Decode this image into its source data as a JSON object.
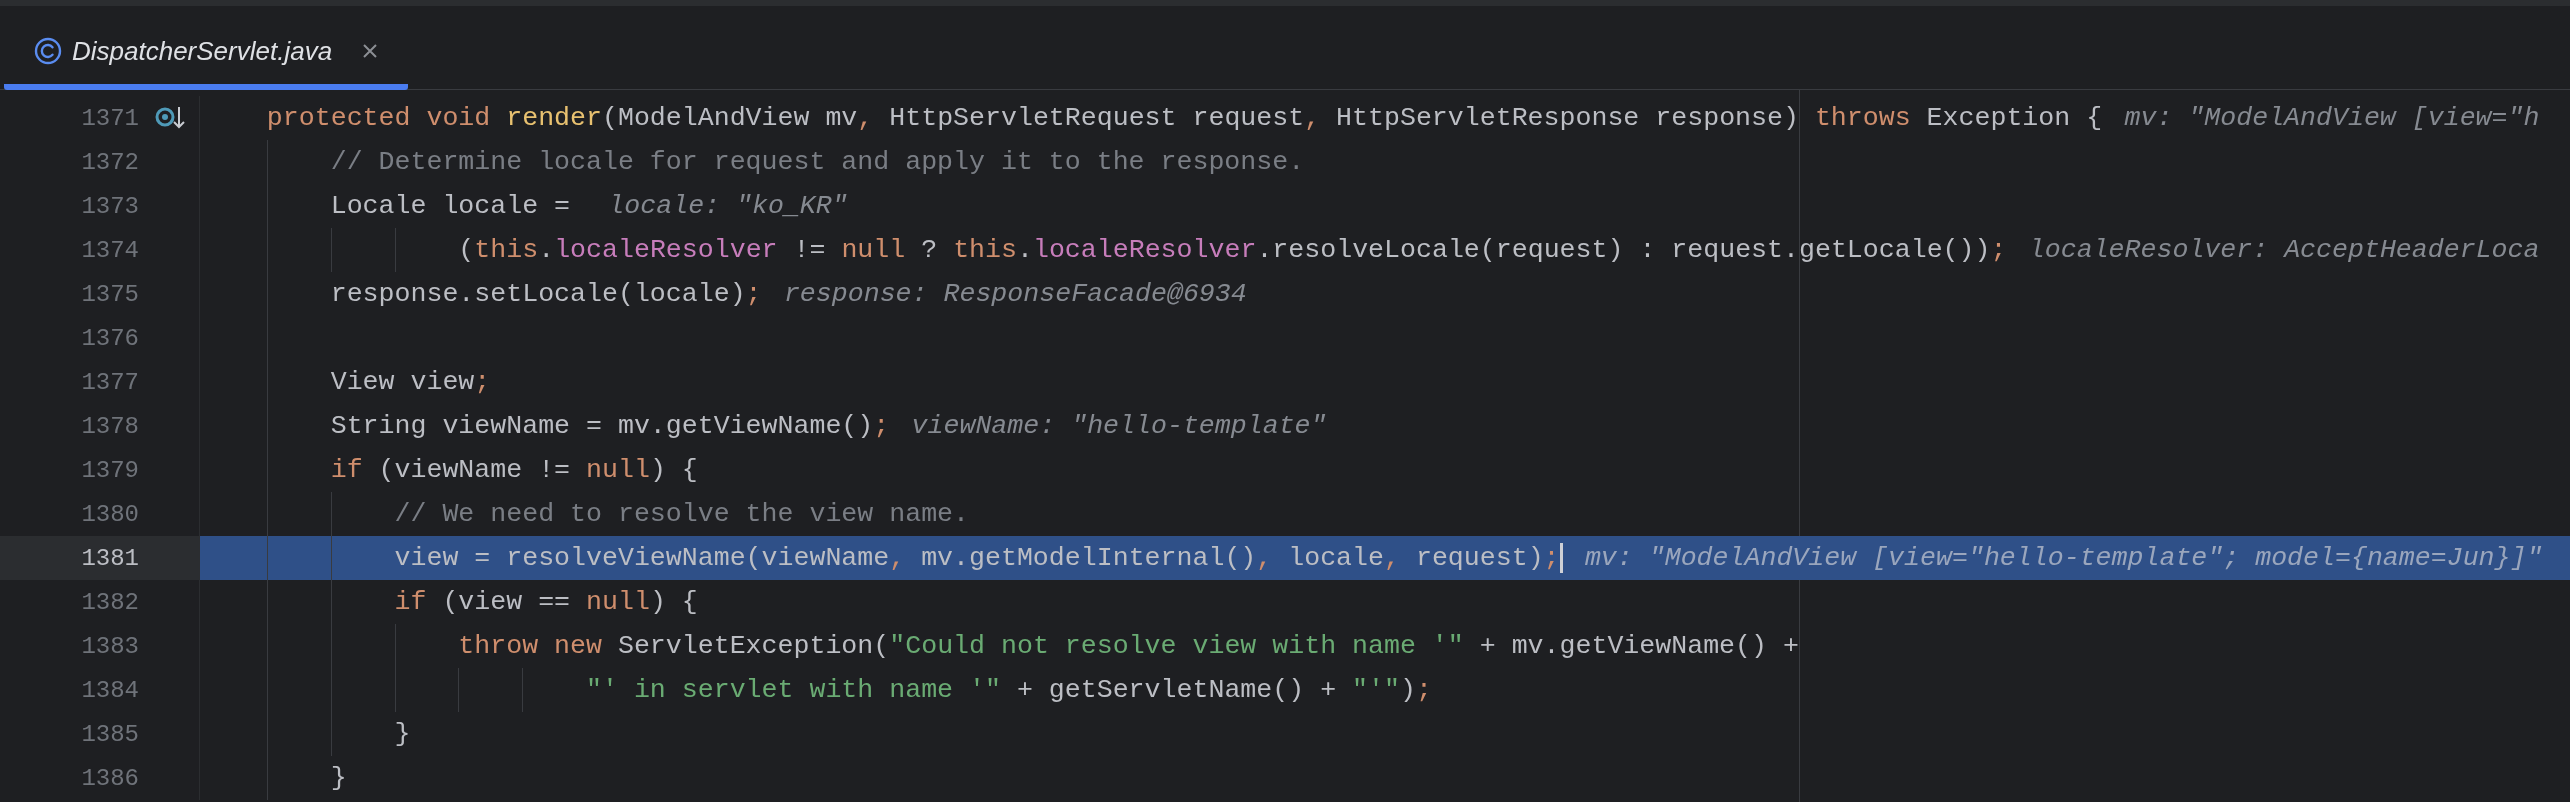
{
  "tabs": [
    {
      "label": "DispatcherServlet.java",
      "selected": true
    }
  ],
  "lines": [
    {
      "number": "1371",
      "current": false,
      "marker": true,
      "tokens": [
        {
          "kind": "keyword",
          "text": "    protected void "
        },
        {
          "kind": "declaration",
          "text": "render"
        },
        {
          "kind": "plain",
          "text": "(ModelAndView mv"
        },
        {
          "kind": "punct",
          "text": ","
        },
        {
          "kind": "plain",
          "text": " HttpServletRequest request"
        },
        {
          "kind": "punct",
          "text": ","
        },
        {
          "kind": "plain",
          "text": " HttpServletResponse response) "
        },
        {
          "kind": "keyword",
          "text": "throws"
        },
        {
          "kind": "plain",
          "text": " Exception {"
        }
      ],
      "hint": "mv: \"ModelAndView [view=\"h"
    },
    {
      "number": "1372",
      "current": false,
      "marker": false,
      "tokens": [
        {
          "kind": "comment",
          "text": "        // Determine locale for request and apply it to the response."
        }
      ]
    },
    {
      "number": "1373",
      "current": false,
      "marker": false,
      "tokens": [
        {
          "kind": "plain",
          "text": "        Locale locale = "
        }
      ],
      "hint": "locale: \"ko_KR\""
    },
    {
      "number": "1374",
      "current": false,
      "marker": false,
      "tokens": [
        {
          "kind": "plain",
          "text": "                ("
        },
        {
          "kind": "keyword",
          "text": "this"
        },
        {
          "kind": "plain",
          "text": "."
        },
        {
          "kind": "field",
          "text": "localeResolver"
        },
        {
          "kind": "plain",
          "text": " != "
        },
        {
          "kind": "keyword",
          "text": "null"
        },
        {
          "kind": "plain",
          "text": " ? "
        },
        {
          "kind": "keyword",
          "text": "this"
        },
        {
          "kind": "plain",
          "text": "."
        },
        {
          "kind": "field",
          "text": "localeResolver"
        },
        {
          "kind": "plain",
          "text": ".resolveLocale(request) : request.getLocale())"
        },
        {
          "kind": "punct",
          "text": ";"
        }
      ],
      "hint": "localeResolver: AcceptHeaderLoca"
    },
    {
      "number": "1375",
      "current": false,
      "marker": false,
      "tokens": [
        {
          "kind": "plain",
          "text": "        response.setLocale(locale)"
        },
        {
          "kind": "punct",
          "text": ";"
        }
      ],
      "hint": "response: ResponseFacade@6934"
    },
    {
      "number": "1376",
      "current": false,
      "marker": false
    },
    {
      "number": "1377",
      "current": false,
      "marker": false,
      "tokens": [
        {
          "kind": "plain",
          "text": "        View view"
        },
        {
          "kind": "punct",
          "text": ";"
        }
      ]
    },
    {
      "number": "1378",
      "current": false,
      "marker": false,
      "tokens": [
        {
          "kind": "plain",
          "text": "        String viewName = mv.getViewName()"
        },
        {
          "kind": "punct",
          "text": ";"
        }
      ],
      "hint": "viewName: \"hello-template\""
    },
    {
      "number": "1379",
      "current": false,
      "marker": false,
      "tokens": [
        {
          "kind": "keyword",
          "text": "        if"
        },
        {
          "kind": "plain",
          "text": " (viewName != "
        },
        {
          "kind": "keyword",
          "text": "null"
        },
        {
          "kind": "plain",
          "text": ") {"
        }
      ]
    },
    {
      "number": "1380",
      "current": false,
      "marker": false,
      "tokens": [
        {
          "kind": "comment",
          "text": "            // We need to resolve the view name."
        }
      ]
    },
    {
      "number": "1381",
      "current": true,
      "marker": false,
      "tokens": [
        {
          "kind": "plain",
          "text": "            view = resolveViewName(viewName"
        },
        {
          "kind": "punct",
          "text": ","
        },
        {
          "kind": "plain",
          "text": " mv.getModelInternal()"
        },
        {
          "kind": "punct",
          "text": ","
        },
        {
          "kind": "plain",
          "text": " locale"
        },
        {
          "kind": "punct",
          "text": ","
        },
        {
          "kind": "plain",
          "text": " request)"
        },
        {
          "kind": "punct",
          "text": ";"
        }
      ],
      "hint": "mv: \"ModelAndView [view=\"hello-template\"; model={name=Jun}]\""
    },
    {
      "number": "1382",
      "current": false,
      "marker": false,
      "tokens": [
        {
          "kind": "keyword",
          "text": "            if"
        },
        {
          "kind": "plain",
          "text": " (view == "
        },
        {
          "kind": "keyword",
          "text": "null"
        },
        {
          "kind": "plain",
          "text": ") {"
        }
      ]
    },
    {
      "number": "1383",
      "current": false,
      "marker": false,
      "tokens": [
        {
          "kind": "keyword",
          "text": "                throw new"
        },
        {
          "kind": "plain",
          "text": " ServletException("
        },
        {
          "kind": "string",
          "text": "\"Could not resolve view with name '\""
        },
        {
          "kind": "plain",
          "text": " + mv.getViewName() +"
        }
      ]
    },
    {
      "number": "1384",
      "current": false,
      "marker": false,
      "tokens": [
        {
          "kind": "string",
          "text": "                        \"' in servlet with name '\""
        },
        {
          "kind": "plain",
          "text": " + getServletName() + "
        },
        {
          "kind": "string",
          "text": "\"'\""
        },
        {
          "kind": "plain",
          "text": ")"
        },
        {
          "kind": "punct",
          "text": ";"
        }
      ]
    },
    {
      "number": "1385",
      "current": false,
      "marker": false,
      "tokens": [
        {
          "kind": "plain",
          "text": "            }"
        }
      ]
    },
    {
      "number": "1386",
      "current": false,
      "marker": false,
      "tokens": [
        {
          "kind": "plain",
          "text": "        }"
        }
      ]
    }
  ]
}
